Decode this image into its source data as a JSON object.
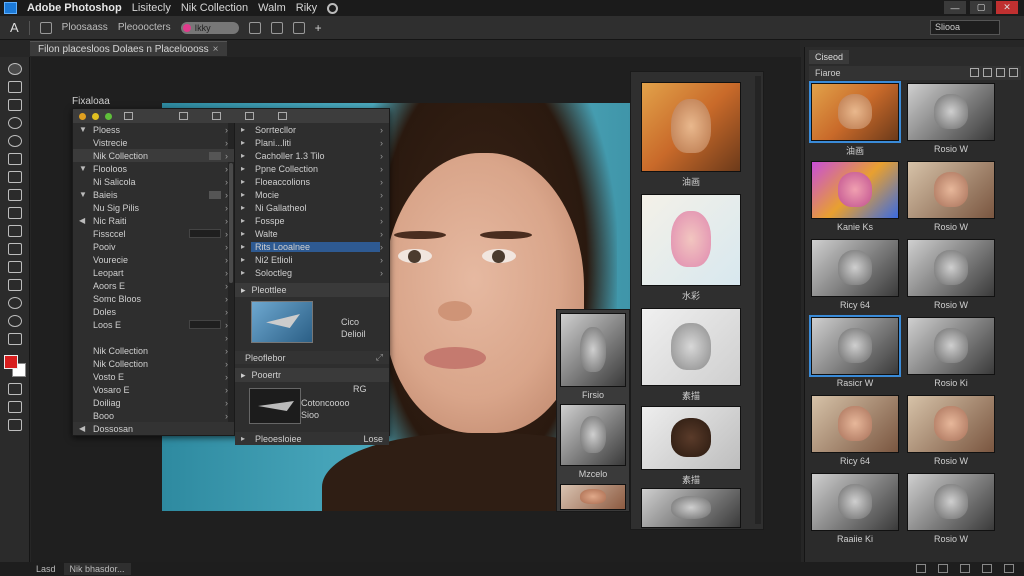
{
  "menubar": {
    "app": "Adobe Photoshop",
    "items": [
      "Lisitecly",
      "Nik Collection",
      "Walm",
      "Riky"
    ]
  },
  "options": {
    "label1": "Ploosaass",
    "label2": "Pleooocters",
    "chip": "Ikky",
    "search": "Sliooa"
  },
  "tabs": [
    {
      "label": "Filon placesloos Dolaes n Placeloooss"
    }
  ],
  "nik": {
    "title": "Fixaloaa",
    "left_rows": [
      {
        "label": "Ploess",
        "tri": "▼",
        "hl": false
      },
      {
        "label": "Vistrecie",
        "tri": "",
        "hl": false
      },
      {
        "label": "Nik Collection",
        "tri": "",
        "hl": true
      },
      {
        "label": "Flooloos",
        "tri": "▼",
        "hl": false
      },
      {
        "label": "Ni Salicola",
        "tri": "",
        "hl": false
      },
      {
        "label": "Baieis",
        "tri": "▼",
        "hl": false
      },
      {
        "label": "Nu Sig Pilis",
        "tri": "",
        "hl": false
      },
      {
        "label": "Nic Raiti",
        "tri": "◀",
        "hl": false
      },
      {
        "label": "Fissccel",
        "tri": "",
        "hl": false
      },
      {
        "label": "Pooiv",
        "tri": "",
        "hl": false
      },
      {
        "label": "Vourecie",
        "tri": "",
        "hl": false
      },
      {
        "label": "Leopart",
        "tri": "",
        "hl": false
      },
      {
        "label": "Aoors E",
        "tri": "",
        "hl": false
      },
      {
        "label": "Somc Bloos",
        "tri": "",
        "hl": false
      },
      {
        "label": "Doles",
        "tri": "",
        "hl": false
      },
      {
        "label": "Loos E",
        "tri": "",
        "hl": false
      },
      {
        "label": "",
        "tri": "",
        "hl": false
      },
      {
        "label": "Nik Collection",
        "tri": "",
        "hl": false
      },
      {
        "label": "Nik Collection",
        "tri": "",
        "hl": false
      },
      {
        "label": "Vosto E",
        "tri": "",
        "hl": false
      },
      {
        "label": "Vosaro E",
        "tri": "",
        "hl": false
      },
      {
        "label": "Doiliag",
        "tri": "",
        "hl": false
      },
      {
        "label": "Booo",
        "tri": "",
        "hl": false
      }
    ],
    "left_footer": "Dossosan",
    "right_rows": [
      {
        "label": "Sorrtecllor",
        "sel": false
      },
      {
        "label": "Plani...liti",
        "sel": false
      },
      {
        "label": "Cacholler 1.3 Tilo",
        "sel": false
      },
      {
        "label": "Ppne Collection",
        "sel": false
      },
      {
        "label": "Floeaccolions",
        "sel": false
      },
      {
        "label": "Mocie",
        "sel": false
      },
      {
        "label": "Ni Gallatheol",
        "sel": false
      },
      {
        "label": "Fosspe",
        "sel": false
      },
      {
        "label": "Walte",
        "sel": false
      },
      {
        "label": "Rits Looalnee",
        "sel": true
      },
      {
        "label": "Ni2 Etlioli",
        "sel": false
      },
      {
        "label": "Soloctleg",
        "sel": false
      }
    ],
    "sec1": {
      "title": "Pleottlee",
      "text1": "Cico",
      "text2": "Delioil",
      "footer": "Pleoflebor"
    },
    "sec2": {
      "title": "Pooertr",
      "text1": "RG",
      "text2": "Cotoncoooo",
      "text3": "Sioo",
      "footer": "Pleoesloiee",
      "footer_right": "Lose"
    }
  },
  "strip_a": [
    {
      "cap": "Firsio",
      "tone": "bw"
    },
    {
      "cap": "Mzcelo",
      "tone": "bw"
    },
    {
      "cap": "",
      "tone": "color"
    }
  ],
  "strip_b": [
    {
      "cap": "油画",
      "tone": "oil"
    },
    {
      "cap": "水彩",
      "tone": "water"
    },
    {
      "cap": "素描",
      "tone": "sketch"
    },
    {
      "cap": "素描",
      "tone": "bw-man"
    },
    {
      "cap": "",
      "tone": "bw"
    }
  ],
  "right_panel": {
    "tab": "Ciseod",
    "subhead": "Fiaroe",
    "thumbs": [
      {
        "cap": "油画",
        "tone": "oil",
        "sel": true
      },
      {
        "cap": "Rosio W",
        "tone": "bw",
        "sel": false
      },
      {
        "cap": "Kanie Ks",
        "tone": "color-vivid",
        "sel": false
      },
      {
        "cap": "Rosio W",
        "tone": "warm",
        "sel": false
      },
      {
        "cap": "Ricy 64",
        "tone": "bw",
        "sel": false
      },
      {
        "cap": "Rosio W",
        "tone": "bw",
        "sel": false
      },
      {
        "cap": "Rasicr W",
        "tone": "bw",
        "sel": true
      },
      {
        "cap": "Rosio Ki",
        "tone": "bw",
        "sel": false
      },
      {
        "cap": "Ricy 64",
        "tone": "warm",
        "sel": false
      },
      {
        "cap": "Rosio W",
        "tone": "warm",
        "sel": false
      },
      {
        "cap": "Raaiie Ki",
        "tone": "bw",
        "sel": false
      },
      {
        "cap": "Rosio W",
        "tone": "bw",
        "sel": false
      }
    ]
  },
  "status": {
    "left": "Lasd",
    "tab": "Nik bhasdor..."
  },
  "colors": {
    "accent": "#3a8bd8",
    "foreground": "#d81e1e",
    "background": "#ffffff"
  }
}
